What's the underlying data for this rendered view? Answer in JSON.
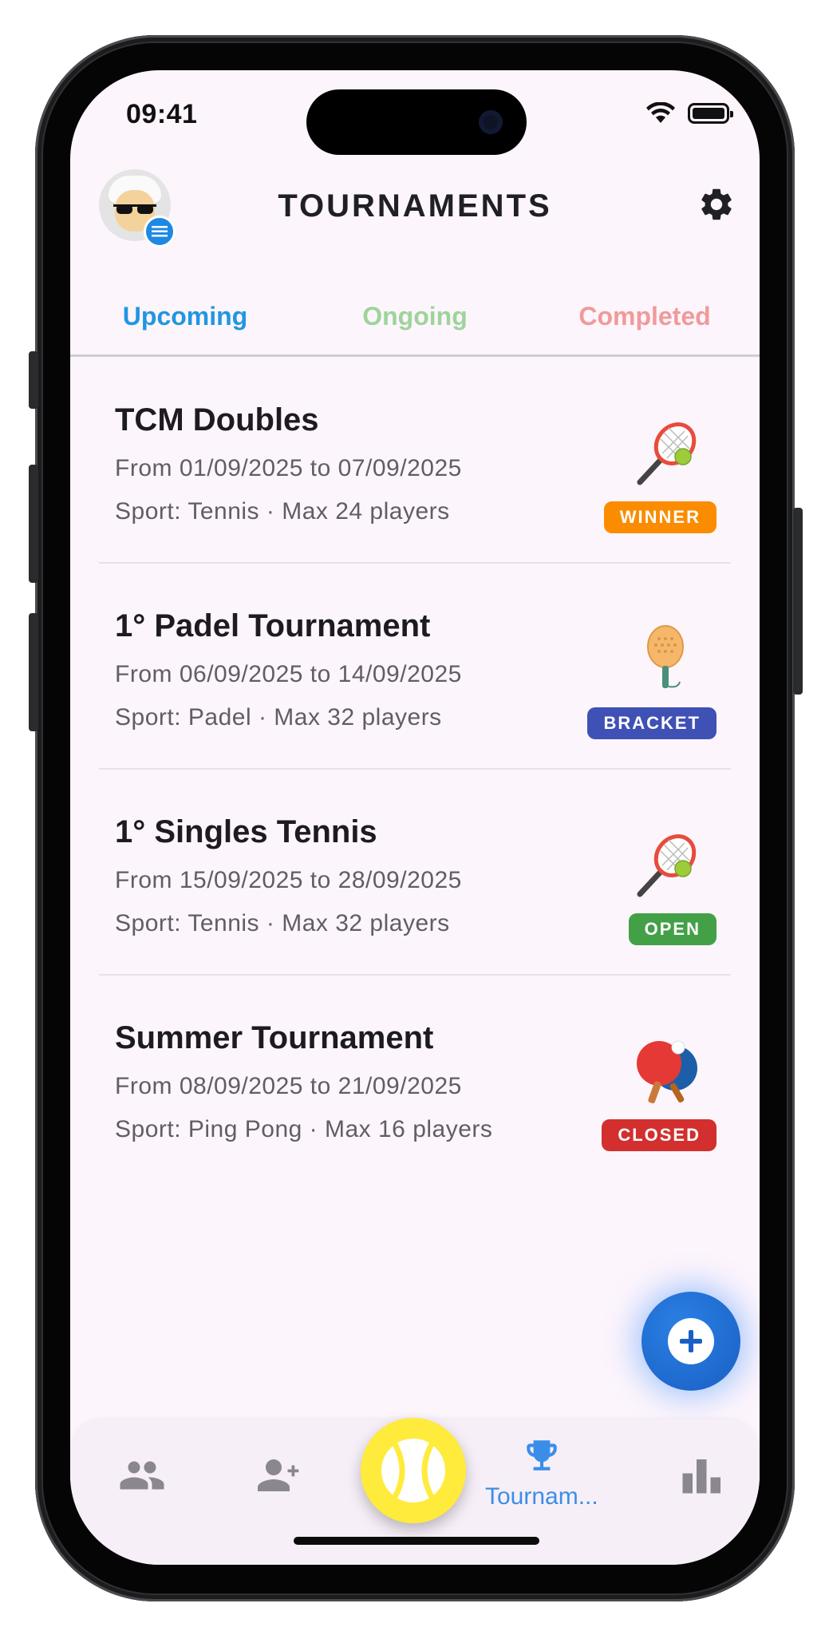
{
  "status_bar": {
    "time": "09:41"
  },
  "header": {
    "title": "TOURNAMENTS"
  },
  "tabs": [
    {
      "label": "Upcoming",
      "color": "#2196e0",
      "active": true
    },
    {
      "label": "Ongoing",
      "color": "#9ed49b"
    },
    {
      "label": "Completed",
      "color": "#f09a9a"
    }
  ],
  "tournaments": [
    {
      "name": "TCM Doubles",
      "dates": "From 01/09/2025 to 07/09/2025",
      "meta": "Sport: Tennis · Max 24 players",
      "icon": "tennis-racket-icon",
      "badge": "WINNER",
      "badge_color": "#fb8c00"
    },
    {
      "name": "1° Padel Tournament",
      "dates": "From 06/09/2025 to 14/09/2025",
      "meta": "Sport: Padel · Max 32 players",
      "icon": "padel-racket-icon",
      "badge": "BRACKET",
      "badge_color": "#3f51b5"
    },
    {
      "name": "1° Singles Tennis",
      "dates": "From 15/09/2025 to 28/09/2025",
      "meta": "Sport: Tennis · Max 32 players",
      "icon": "tennis-racket-icon",
      "badge": "OPEN",
      "badge_color": "#43a047"
    },
    {
      "name": "Summer Tournament",
      "dates": "From 08/09/2025 to 21/09/2025",
      "meta": "Sport: Ping Pong · Max 16 players",
      "icon": "ping-pong-icon",
      "badge": "CLOSED",
      "badge_color": "#d32f2f"
    }
  ],
  "bottom_nav": {
    "items": [
      {
        "icon": "people-icon"
      },
      {
        "icon": "add-person-icon"
      },
      {
        "icon": "tennis-ball-icon"
      },
      {
        "icon": "trophy-icon",
        "label": "Tournam...",
        "active": true
      },
      {
        "icon": "bar-chart-icon"
      }
    ]
  },
  "fab": {
    "icon": "plus-icon"
  },
  "colors": {
    "accent": "#2196e0",
    "background": "#fdf5fc",
    "nav_active": "#3b8ee8"
  }
}
